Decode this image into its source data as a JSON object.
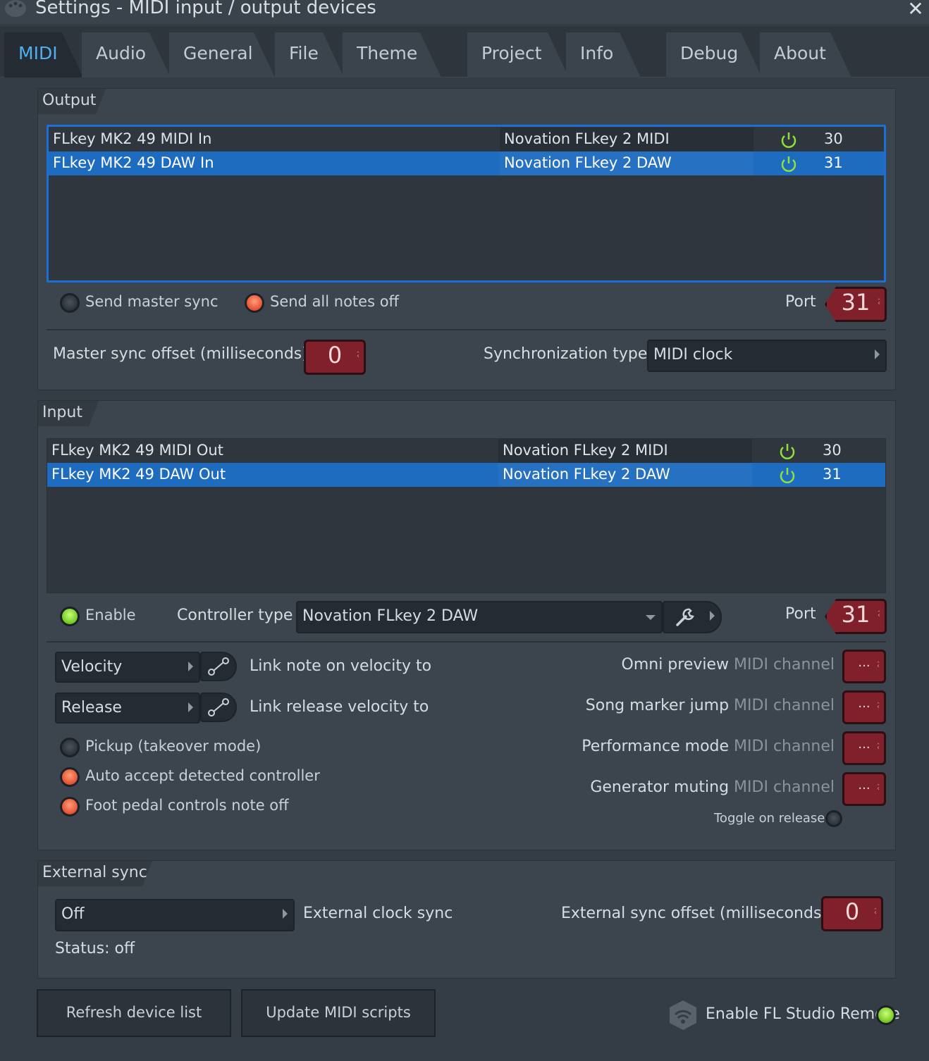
{
  "window": {
    "title": "Settings - MIDI input / output devices",
    "app_icon": "fl-studio-icon",
    "close_icon": "close-icon",
    "close_glyph": "✕"
  },
  "tabs": [
    {
      "label": "MIDI",
      "active": true
    },
    {
      "label": "Audio"
    },
    {
      "label": "General"
    },
    {
      "label": "File"
    },
    {
      "label": "Theme"
    },
    {
      "label": "Project"
    },
    {
      "label": "Info"
    },
    {
      "label": "Debug"
    },
    {
      "label": "About"
    }
  ],
  "output": {
    "heading": "Output",
    "rows": [
      {
        "name": "FLkey MK2 49 MIDI In",
        "driver": "Novation FLkey 2 MIDI",
        "power_icon": "power-icon",
        "port": "30",
        "selected": false
      },
      {
        "name": "FLkey MK2 49 DAW In",
        "driver": "Novation FLkey 2 DAW",
        "power_icon": "power-icon",
        "port": "31",
        "selected": true
      }
    ],
    "send_master_sync": "Send master sync",
    "send_all_notes_off": "Send all notes off",
    "port_label": "Port",
    "port_value": "31",
    "master_sync_offset_label": "Master sync offset (milliseconds)",
    "master_sync_offset_value": "0",
    "sync_type_label": "Synchronization type",
    "sync_type_value": "MIDI clock"
  },
  "input": {
    "heading": "Input",
    "rows": [
      {
        "name": "FLkey MK2 49 MIDI Out",
        "driver": "Novation FLkey 2 MIDI",
        "power_icon": "power-icon",
        "port": "30",
        "selected": false
      },
      {
        "name": "FLkey MK2 49 DAW Out",
        "driver": "Novation FLkey 2 DAW",
        "power_icon": "power-icon",
        "port": "31",
        "selected": true
      }
    ],
    "enable_label": "Enable",
    "controller_type_label": "Controller type",
    "controller_type_value": "Novation FLkey 2 DAW",
    "wrench_icon": "wrench-icon",
    "port_label": "Port",
    "port_value": "31",
    "velocity_select": "Velocity",
    "velocity_link_label": "Link note on velocity to",
    "release_select": "Release",
    "release_link_label": "Link release velocity to",
    "pickup_label": "Pickup (takeover mode)",
    "auto_accept_label": "Auto accept detected controller",
    "foot_pedal_label": "Foot pedal controls note off",
    "omni_preview_label": "Omni preview",
    "song_marker_label": "Song marker jump",
    "performance_label": "Performance mode",
    "generator_muting_label": "Generator muting",
    "midi_channel_suffix": "MIDI channel",
    "channel_value": "···",
    "toggle_on_release_label": "Toggle on release"
  },
  "external_sync": {
    "heading": "External sync",
    "clock_value": "Off",
    "clock_label": "External clock sync",
    "offset_label": "External sync offset (milliseconds)",
    "offset_value": "0",
    "status": "Status: off"
  },
  "footer": {
    "refresh_label": "Refresh device list",
    "update_label": "Update MIDI scripts",
    "remote_label": "Enable FL Studio Remote",
    "remote_icon": "remote-wifi-icon"
  },
  "colors": {
    "accent_blue": "#1e6cc0",
    "active_tab_text": "#4fb0f0",
    "power_green": "#8fe03a",
    "number_box_red": "#80202a",
    "led_orange": "#e04b2e",
    "led_green": "#6bc21b"
  }
}
